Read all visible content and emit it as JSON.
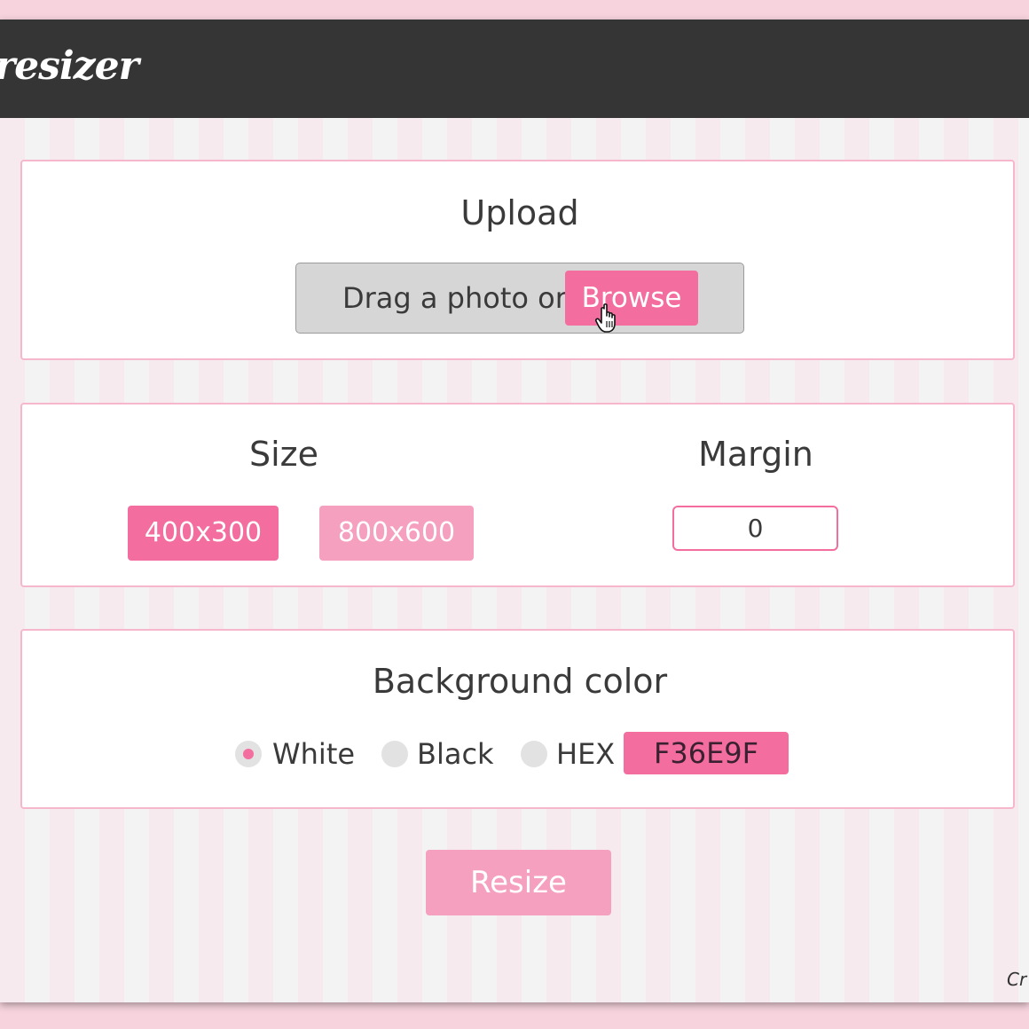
{
  "header": {
    "brand": "resizer"
  },
  "upload": {
    "title": "Upload",
    "drop_text": "Drag a photo or",
    "browse_label": "Browse"
  },
  "size": {
    "title": "Size",
    "options": [
      {
        "label": "400x300",
        "selected": true
      },
      {
        "label": "800x600",
        "selected": false
      }
    ]
  },
  "margin": {
    "title": "Margin",
    "value": "0"
  },
  "background": {
    "title": "Background color",
    "options": [
      {
        "label": "White",
        "selected": true
      },
      {
        "label": "Black",
        "selected": false
      },
      {
        "label": "HEX",
        "selected": false
      }
    ],
    "hex_value": "F36E9F"
  },
  "actions": {
    "resize_label": "Resize"
  },
  "footer": {
    "credit": "Cr"
  },
  "colors": {
    "accent": "#f36e9f",
    "accent_light": "#f6a0bf",
    "topbar": "#353535"
  },
  "icons": {
    "cursor": "hand-pointer-icon"
  }
}
